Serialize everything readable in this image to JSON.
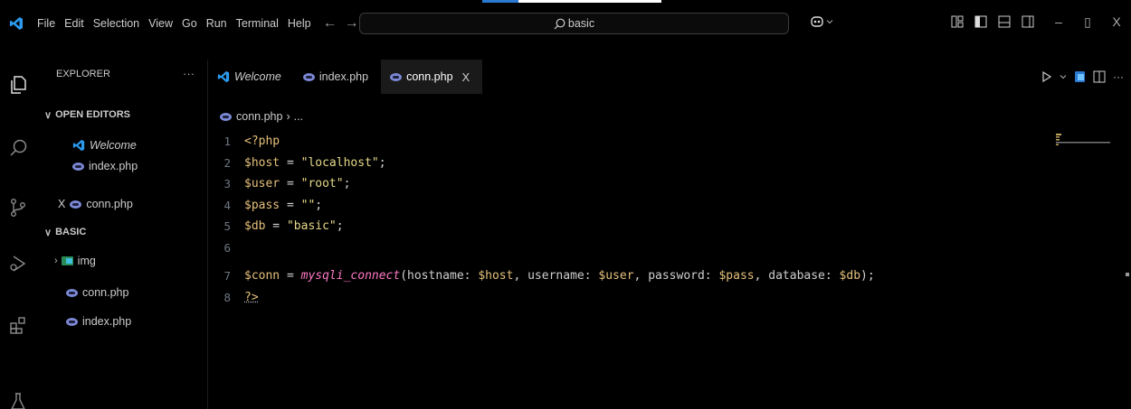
{
  "menu": [
    "File",
    "Edit",
    "Selection",
    "View",
    "Go",
    "Run",
    "Terminal",
    "Help"
  ],
  "nav": {
    "back": "←",
    "forward": "→"
  },
  "search": {
    "value": "basic"
  },
  "window": {
    "minimize": "–",
    "restore": "▯",
    "close": "X"
  },
  "explorer": {
    "title": "EXPLORER",
    "more": "···",
    "open_editors_label": "OPEN EDITORS",
    "open_editors": [
      {
        "name": "Welcome"
      },
      {
        "name": "index.php"
      },
      {
        "name": "conn.php",
        "close": "X"
      }
    ],
    "folder_label": "BASIC",
    "folder_items": [
      {
        "name": "img"
      },
      {
        "name": "conn.php"
      },
      {
        "name": "index.php"
      }
    ]
  },
  "tabs": [
    {
      "label": "Welcome"
    },
    {
      "label": "index.php"
    },
    {
      "label": "conn.php",
      "close": "X",
      "active": true
    }
  ],
  "editor_actions": {
    "more": "···"
  },
  "breadcrumb": {
    "file": "conn.php",
    "sep": "›",
    "rest": "..."
  },
  "code": {
    "line_numbers": [
      "1",
      "2",
      "3",
      "4",
      "5",
      "6",
      "7",
      "8"
    ],
    "l1": "<?php",
    "l2_var": "$host",
    "l2_eq": " = ",
    "l2_str": "\"localhost\"",
    "l2_end": ";",
    "l3_var": "$user",
    "l3_eq": " = ",
    "l3_str": "\"root\"",
    "l3_end": ";",
    "l4_var": "$pass",
    "l4_eq": " = ",
    "l4_str": "\"\"",
    "l4_end": ";",
    "l5_var": "$db",
    "l5_eq": " = ",
    "l5_str": "\"basic\"",
    "l5_end": ";",
    "l7_var": "$conn",
    "l7_eq": " = ",
    "l7_fn": "mysqli_connect",
    "l7_open": "(",
    "l7_h1": "hostname: ",
    "l7_a1": "$host",
    "l7_c1": ", ",
    "l7_h2": "username: ",
    "l7_a2": "$user",
    "l7_c2": ", ",
    "l7_h3": "password: ",
    "l7_a3": "$pass",
    "l7_c3": ", ",
    "l7_h4": "database: ",
    "l7_a4": "$db",
    "l7_close": ");",
    "l8": "?>"
  },
  "colors": {
    "accent": "#2b79d0",
    "background": "#000000",
    "active_tab": "#1a1a1a",
    "php_icon": "#7c89d4",
    "variable": "#e5c07b",
    "string": "#e6d98a",
    "function": "#ff79c6"
  }
}
